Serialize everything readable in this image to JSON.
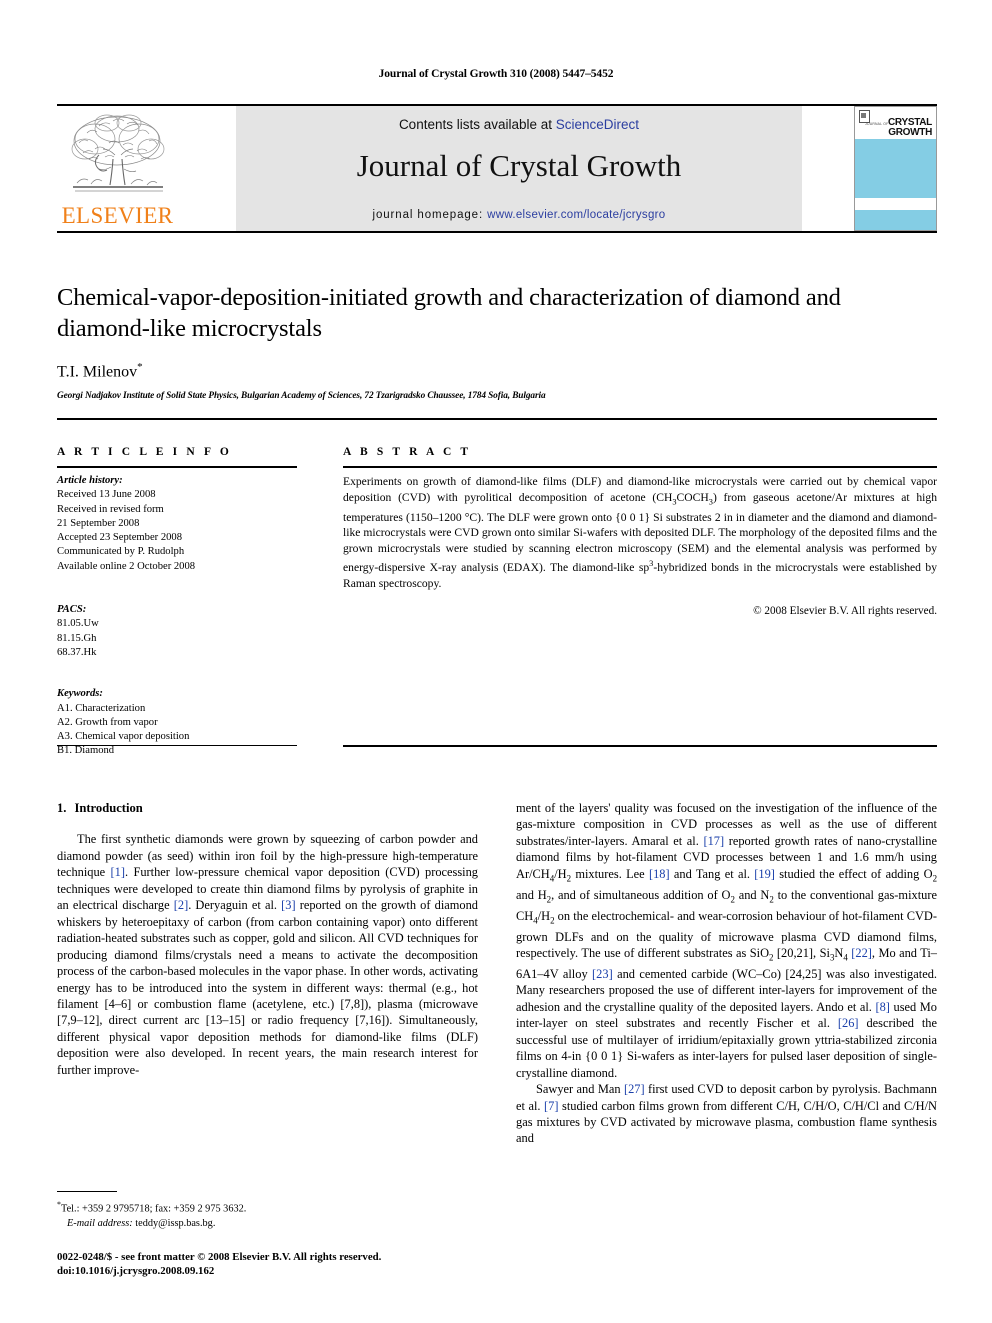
{
  "running_head": "Journal of Crystal Growth 310 (2008) 5447–5452",
  "masthead": {
    "publisher_name": "ELSEVIER",
    "publisher_logo": "elsevier-tree-logo",
    "contents_prefix": "Contents lists available at ",
    "contents_link": "ScienceDirect",
    "journal_title": "Journal of Crystal Growth",
    "homepage_prefix": "journal homepage: ",
    "homepage_url": "www.elsevier.com/locate/jcrysgro",
    "cover": {
      "small_label": "JOURNAL OF",
      "big_label_line1": "CRYSTAL",
      "big_label_line2": "GROWTH",
      "accent_color": "#84cde4"
    }
  },
  "article": {
    "title": "Chemical-vapor-deposition-initiated growth and characterization of diamond and diamond-like microcrystals",
    "authors": "T.I. Milenov",
    "author_marker": "*",
    "affiliation": "Georgi Nadjakov Institute of Solid State Physics, Bulgarian Academy of Sciences, 72 Tzarigradsko Chaussee, 1784 Sofia, Bulgaria"
  },
  "info": {
    "heading": "A R T I C L E   I N F O",
    "history_label": "Article history:",
    "history": [
      "Received 13 June 2008",
      "Received in revised form",
      "21 September 2008",
      "Accepted 23 September 2008",
      "Communicated by P. Rudolph",
      "Available online 2 October 2008"
    ],
    "pacs_label": "PACS:",
    "pacs": [
      "81.05.Uw",
      "81.15.Gh",
      "68.37.Hk"
    ],
    "keywords_label": "Keywords:",
    "keywords": [
      "A1. Characterization",
      "A2. Growth from vapor",
      "A3. Chemical vapor deposition",
      "B1. Diamond"
    ]
  },
  "abstract": {
    "heading": "A B S T R A C T",
    "body_1": "Experiments on growth of diamond-like films (DLF) and diamond-like microcrystals were carried out by chemical vapor deposition (CVD) with pyrolitical decomposition of acetone (CH",
    "formula_sub_1": "3",
    "body_2": "COCH",
    "formula_sub_2": "3",
    "body_3": ") from gaseous acetone/Ar mixtures at high temperatures (1150–1200 °C). The DLF were grown onto {0 0 1} Si substrates 2 in in diameter and the diamond and diamond-like microcrystals were CVD grown onto similar Si-wafers with deposited DLF. The morphology of the deposited films and the grown microcrystals were studied by scanning electron microscopy (SEM) and the elemental analysis was performed by energy-dispersive X-ray analysis (EDAX). The diamond-like sp",
    "sp_sup": "3",
    "body_4": "-hybridized bonds in the microcrystals were established by Raman spectroscopy.",
    "copyright": "© 2008 Elsevier B.V. All rights reserved."
  },
  "body": {
    "section_number": "1.",
    "section_title": "Introduction",
    "left_column": {
      "para_1_a": "The first synthetic diamonds were grown by squeezing of carbon powder and diamond powder (as seed) within iron foil by the high-pressure high-temperature technique ",
      "ref_1": "[1]",
      "para_1_b": ". Further low-pressure chemical vapor deposition (CVD) processing techniques were developed to create thin diamond films by pyrolysis of graphite in an electrical discharge ",
      "ref_2": "[2]",
      "para_1_c": ". Deryaguin et al. ",
      "ref_3": "[3]",
      "para_1_d": " reported on the growth of diamond whiskers by heteroepitaxy of carbon (from carbon containing vapor) onto different radiation-heated substrates such as copper, gold and silicon. All CVD techniques for producing diamond films/crystals need a means to activate the decomposition process of the carbon-based molecules in the vapor phase. In other words, activating energy has to be introduced into the system in different ways: thermal (e.g., hot filament [4–6] or combustion flame (acetylene, etc.) [7,8]), plasma (microwave [7,9–12], direct current arc [13–15] or radio frequency [7,16]). Simultaneously, different physical vapor deposition methods for diamond-like films (DLF) deposition were also developed. In recent years, the main research interest for further improve-"
    },
    "right_column": {
      "para_1_a": "ment of the layers' quality was focused on the investigation of the influence of the gas-mixture composition in CVD processes as well as the use of different substrates/inter-layers. Amaral et al. ",
      "ref_17": "[17]",
      "para_1_b": " reported growth rates of nano-crystalline diamond films by hot-filament CVD processes between 1 and 1.6 mm/h using Ar/CH",
      "sub_4": "4",
      "para_1_c": "/H",
      "sub_2a": "2",
      "para_1_d": " mixtures. Lee ",
      "ref_18": "[18]",
      "para_1_e": " and Tang et al. ",
      "ref_19": "[19]",
      "para_1_f": " studied the effect of adding O",
      "sub_2b": "2",
      "para_1_g": " and H",
      "sub_2c": "2",
      "para_1_h": ", and of simultaneous addition of O",
      "sub_2d": "2",
      "para_1_i": " and N",
      "sub_2e": "2",
      "para_1_j": " to the conventional gas-mixture CH",
      "sub_4b": "4",
      "para_1_k": "/H",
      "sub_2f": "2",
      "para_1_l": " on the electrochemical- and wear-corrosion behaviour of hot-filament CVD-grown DLFs and on the quality of microwave plasma CVD diamond films, respectively. The use of different substrates as SiO",
      "sub_2g": "2",
      "para_1_m": " [20,21], Si",
      "sub_3": "3",
      "para_1_n": "N",
      "sub_4c": "4",
      "para_1_o": " ",
      "ref_22": "[22]",
      "para_1_p": ", Mo and Ti–6A1–4V alloy ",
      "ref_23": "[23]",
      "para_1_q": " and cemented carbide (WC–Co) [24,25] was also investigated. Many researchers proposed the use of different inter-layers for improvement of the adhesion and the crystalline quality of the deposited layers. Ando et al. ",
      "ref_8": "[8]",
      "para_1_r": " used Mo inter-layer on steel substrates and recently Fischer et al. ",
      "ref_26": "[26]",
      "para_1_s": " described the successful use of multilayer of irridium/epitaxially grown yttria-stabilized zirconia films on 4-in {0 0 1} Si-wafers as inter-layers for pulsed laser deposition of single-crystalline diamond.",
      "para_2_a": "Sawyer and Man ",
      "ref_27": "[27]",
      "para_2_b": " first used CVD to deposit carbon by pyrolysis. Bachmann et al. ",
      "ref_7": "[7]",
      "para_2_c": " studied carbon films grown from different C/H, C/H/O, C/H/Cl and C/H/N gas mixtures by CVD activated by microwave plasma, combustion flame synthesis and"
    }
  },
  "footnote": {
    "marker": "*",
    "contact": "Tel.: +359 2 9795718; fax: +359 2 975 3632.",
    "email_label": "E-mail address:",
    "email": " teddy@issp.bas.bg."
  },
  "imprint": {
    "line_1": "0022-0248/$ - see front matter © 2008 Elsevier B.V. All rights reserved.",
    "line_2": "doi:10.1016/j.jcrysgro.2008.09.162"
  },
  "colors": {
    "link": "#2b3ea0",
    "reference": "#1a3faa",
    "elsevier_orange": "#f08019",
    "cover_blue": "#84cde4",
    "band_gray": "#e4e4e4"
  }
}
